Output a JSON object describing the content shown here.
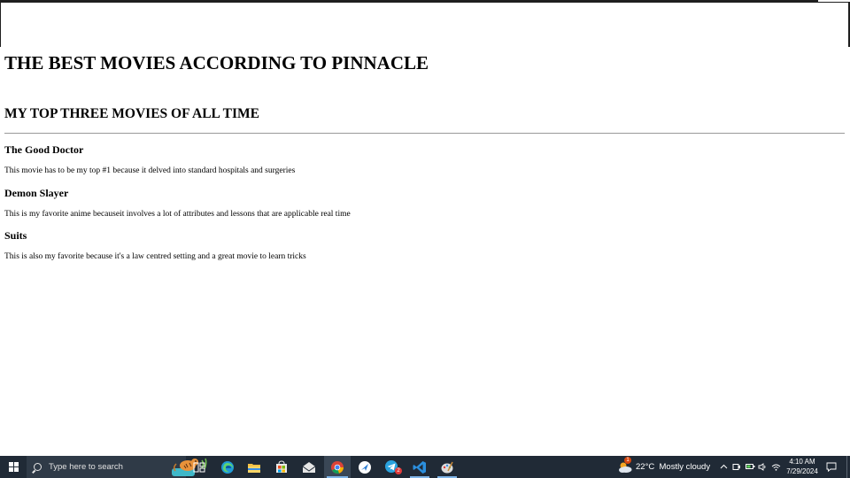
{
  "page": {
    "heading": "THE BEST MOVIES ACCORDING TO PINNACLE",
    "subheading": "MY TOP THREE MOVIES OF ALL TIME",
    "movies": [
      {
        "title": "The Good Doctor",
        "description": "This movie has to be my top #1 because it delved into standard hospitals and surgeries"
      },
      {
        "title": "Demon Slayer",
        "description": "This is my favorite anime becauseit involves a lot of attributes and lessons that are applicable real time"
      },
      {
        "title": "Suits",
        "description": "This is also my favorite because it's a law centred setting and a great movie to learn tricks"
      }
    ]
  },
  "taskbar": {
    "search_placeholder": "Type here to search",
    "weather": {
      "temperature": "22°C",
      "condition": "Mostly cloudy",
      "alert_badge": "1"
    },
    "clock": {
      "time": "4:10 AM",
      "date": "7/29/2024"
    },
    "telegram_badge": "2",
    "pinned_apps": [
      "task-view-icon",
      "edge-icon",
      "file-explorer-icon",
      "microsoft-store-icon",
      "mail-icon",
      "chrome-icon",
      "feather-app-icon",
      "telegram-icon",
      "vscode-icon",
      "paint-icon"
    ],
    "colors": {
      "taskbar_bg": "#202a36",
      "search_bg": "#2f3a47",
      "active_indicator": "#7fb5e8"
    }
  }
}
